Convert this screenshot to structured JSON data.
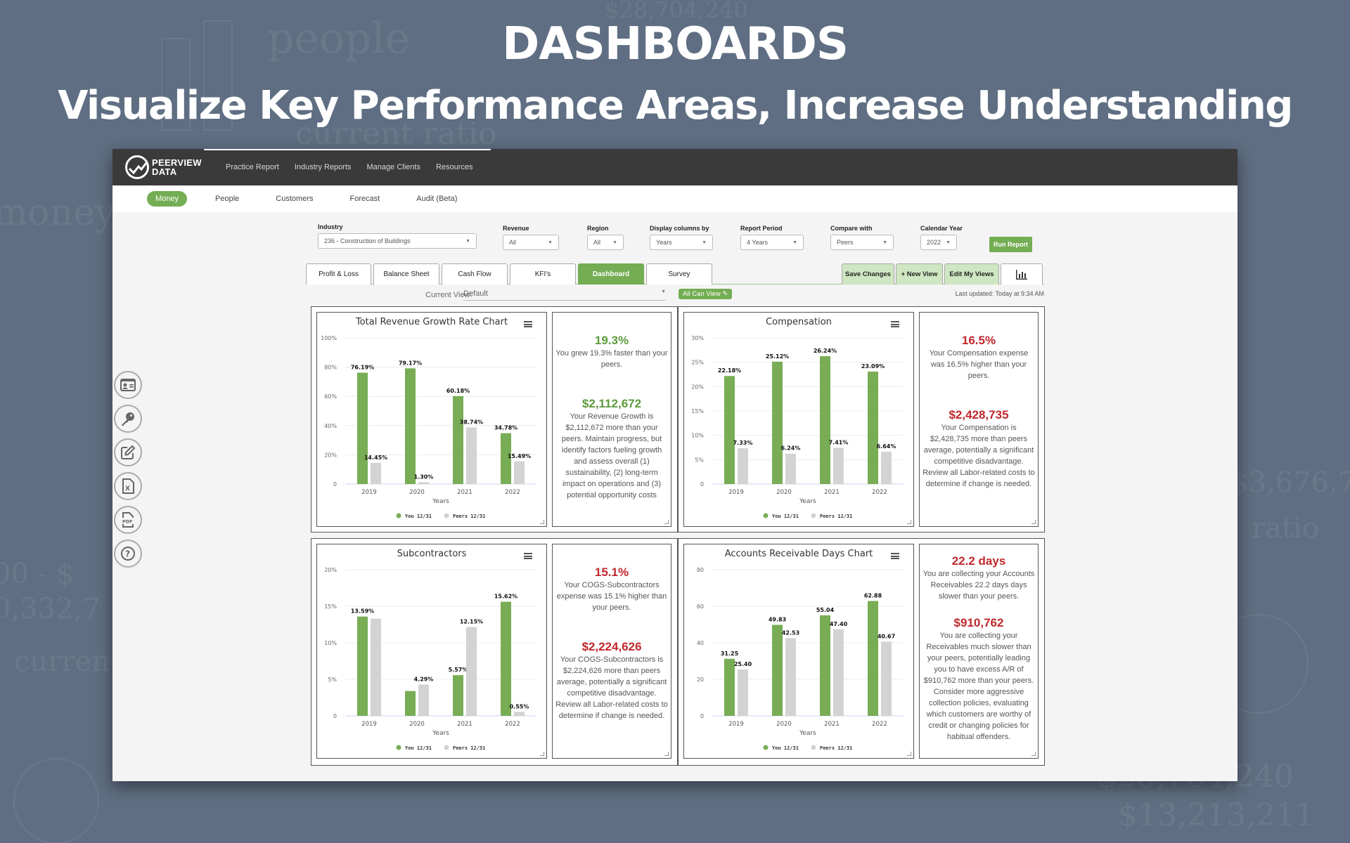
{
  "hero": {
    "title": "DASHBOARDS",
    "subtitle": "Visualize Key Performance Areas, Increase Understanding"
  },
  "app": {
    "logo_line1": "PEERVIEW",
    "logo_line2": "DATA",
    "top_nav": [
      "Practice Report",
      "Industry Reports",
      "Manage Clients",
      "Resources"
    ],
    "sub_nav": [
      {
        "label": "Money",
        "active": true
      },
      {
        "label": "People",
        "active": false
      },
      {
        "label": "Customers",
        "active": false
      },
      {
        "label": "Forecast",
        "active": false
      },
      {
        "label": "Audit (Beta)",
        "active": false
      }
    ],
    "filters": {
      "industry": {
        "label": "Industry",
        "value": "236 - Construction of Buildings"
      },
      "revenue": {
        "label": "Revenue",
        "value": "All"
      },
      "region": {
        "label": "Region",
        "value": "All"
      },
      "display": {
        "label": "Display columns by",
        "value": "Years"
      },
      "period": {
        "label": "Report Period",
        "value": "4 Years"
      },
      "compare": {
        "label": "Compare with",
        "value": "Peers"
      },
      "year": {
        "label": "Calendar Year",
        "value": "2022"
      },
      "run_label": "Run Report"
    },
    "tabs": [
      "Profit & Loss",
      "Balance Sheet",
      "Cash Flow",
      "KFI's",
      "Dashboard",
      "Survey"
    ],
    "active_tab": "Dashboard",
    "view_actions": [
      "Save Changes",
      "+ New View",
      "Edit My Views"
    ],
    "view_bar": {
      "current_view_label": "Current View:",
      "current_view_value": "Default",
      "visibility_label": "All Can View",
      "last_updated": "Last updated: Today at 9:34 AM"
    },
    "side_icons": [
      "contact-card-icon",
      "key-icon",
      "edit-icon",
      "excel-export-icon",
      "pdf-export-icon",
      "help-icon"
    ],
    "colors": {
      "you": "#78ad55",
      "peers": "#d3d3d3",
      "positive": "#5d9b3c",
      "negative": "#c0272d"
    }
  },
  "panels": [
    {
      "metric": {
        "value": "19.3%",
        "desc": "You grew 19.3% faster than your peers.",
        "tone": "green"
      },
      "amount": {
        "value": "$2,112,672",
        "desc": "Your Revenue Growth is $2,112,672 more than your peers. Maintain progress, but identify factors fueling growth and assess overall (1) sustainability, (2) long-term impact on operations and (3) potential opportunity costs",
        "tone": "green"
      }
    },
    {
      "metric": {
        "value": "16.5%",
        "desc": "Your Compensation expense was 16.5% higher than your peers.",
        "tone": "red"
      },
      "amount": {
        "value": "$2,428,735",
        "desc": "Your Compensation is $2,428,735 more than peers average, potentially a significant competitive disadvantage. Review all Labor-related costs to determine if change is needed.",
        "tone": "red"
      }
    },
    {
      "metric": {
        "value": "15.1%",
        "desc": "Your COGS-Subcontractors expense was 15.1% higher than your peers.",
        "tone": "red"
      },
      "amount": {
        "value": "$2,224,626",
        "desc": "Your COGS-Subcontractors is $2,224,626 more than peers average, potentially a significant competitive disadvantage. Review all Labor-related costs to determine if change is needed.",
        "tone": "red"
      }
    },
    {
      "metric": {
        "value": "22.2 days",
        "desc": "You are collecting your Accounts Receivables 22.2 days days slower than your peers.",
        "tone": "red"
      },
      "amount": {
        "value": "$910,762",
        "desc": "You are collecting your Receivables much slower than your peers, potentially leading you to have excess A/R of $910,762 more than your peers. Consider more aggressive collection policies, evaluating which customers are worthy of credit or changing policies for habitual offenders.",
        "tone": "red"
      }
    }
  ],
  "chart_data": [
    {
      "type": "bar",
      "title": "Total Revenue Growth Rate Chart",
      "xlabel": "Years",
      "ylabel": "",
      "categories": [
        "2019",
        "2020",
        "2021",
        "2022"
      ],
      "ylim": [
        0,
        100
      ],
      "yticks": [
        0,
        20,
        40,
        60,
        80,
        100
      ],
      "ytick_labels": [
        "0",
        "20%",
        "40%",
        "60%",
        "80%",
        "100%"
      ],
      "suffix": "%",
      "series": [
        {
          "name": "You 12/31",
          "values": [
            76.19,
            79.17,
            60.18,
            34.78
          ],
          "labels": [
            "76.19%",
            "79.17%",
            "60.18%",
            "34.78%"
          ]
        },
        {
          "name": "Peers 12/31",
          "values": [
            14.45,
            1.3,
            38.74,
            15.49
          ],
          "labels": [
            "14.45%",
            "1.30%",
            "38.74%",
            "15.49%"
          ]
        }
      ],
      "legend": "bottom-center",
      "grid": true
    },
    {
      "type": "bar",
      "title": "Compensation",
      "xlabel": "Years",
      "ylabel": "",
      "categories": [
        "2019",
        "2020",
        "2021",
        "2022"
      ],
      "ylim": [
        0,
        30
      ],
      "yticks": [
        0,
        5,
        10,
        15,
        20,
        25,
        30
      ],
      "ytick_labels": [
        "0",
        "5%",
        "10%",
        "15%",
        "20%",
        "25%",
        "30%"
      ],
      "series": [
        {
          "name": "You 12/31",
          "values": [
            22.18,
            25.12,
            26.24,
            23.09
          ],
          "labels": [
            "22.18%",
            "25.12%",
            "26.24%",
            "23.09%"
          ]
        },
        {
          "name": "Peers 12/31",
          "values": [
            7.33,
            6.24,
            7.41,
            6.64
          ],
          "labels": [
            "7.33%",
            "6.24%",
            "7.41%",
            "6.64%"
          ]
        }
      ],
      "legend": "bottom-center",
      "grid": true
    },
    {
      "type": "bar",
      "title": "Subcontractors",
      "xlabel": "Years",
      "ylabel": "",
      "categories": [
        "2019",
        "2020",
        "2021",
        "2022"
      ],
      "ylim": [
        0,
        20
      ],
      "yticks": [
        0,
        5,
        10,
        15,
        20
      ],
      "ytick_labels": [
        "0",
        "5%",
        "10%",
        "15%",
        "20%"
      ],
      "series": [
        {
          "name": "You 12/31",
          "values": [
            13.59,
            3.4,
            5.57,
            15.62
          ],
          "labels": [
            "13.59%",
            "",
            "5.57%",
            "15.62%"
          ]
        },
        {
          "name": "Peers 12/31",
          "values": [
            13.3,
            4.29,
            12.15,
            0.55
          ],
          "labels": [
            "",
            "4.29%",
            "12.15%",
            "0.55%"
          ]
        }
      ],
      "legend": "bottom-center",
      "grid": true
    },
    {
      "type": "bar",
      "title": "Accounts Receivable Days Chart",
      "xlabel": "Years",
      "ylabel": "",
      "categories": [
        "2019",
        "2020",
        "2021",
        "2022"
      ],
      "ylim": [
        0,
        80
      ],
      "yticks": [
        0,
        20,
        40,
        60,
        80
      ],
      "ytick_labels": [
        "0",
        "20",
        "40",
        "60",
        "80"
      ],
      "series": [
        {
          "name": "You 12/31",
          "values": [
            31.25,
            49.83,
            55.04,
            62.88
          ],
          "labels": [
            "31.25",
            "49.83",
            "55.04",
            "62.88"
          ]
        },
        {
          "name": "Peers 12/31",
          "values": [
            25.4,
            42.53,
            47.4,
            40.67
          ],
          "labels": [
            "25.40",
            "42.53",
            "47.40",
            "40.67"
          ]
        }
      ],
      "legend": "bottom-center",
      "grid": true
    }
  ]
}
